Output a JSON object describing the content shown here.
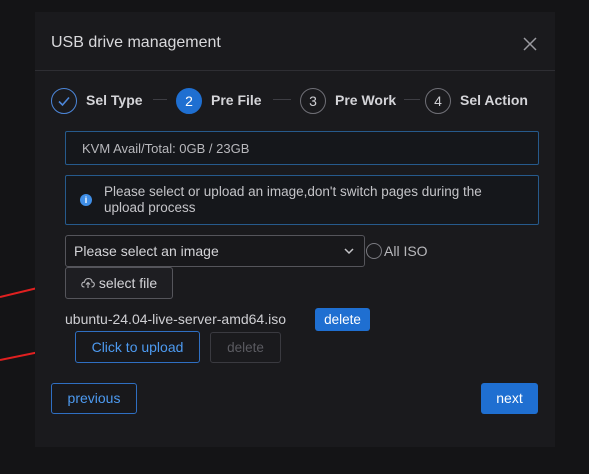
{
  "dialog": {
    "title": "USB drive management"
  },
  "steps": [
    {
      "number": "",
      "label": "Sel Type",
      "state": "done"
    },
    {
      "number": "2",
      "label": "Pre File",
      "state": "active"
    },
    {
      "number": "3",
      "label": "Pre Work",
      "state": "pending"
    },
    {
      "number": "4",
      "label": "Sel Action",
      "state": "pending"
    }
  ],
  "kvm_info": "KVM Avail/Total: 0GB / 23GB",
  "alert": {
    "icon": "info-icon",
    "text": "Please select or upload an image,don't switch pages during the upload process"
  },
  "image_select": {
    "placeholder": "Please select an image",
    "all_iso_label": "All ISO"
  },
  "select_file_label": "select file",
  "uploaded_file": {
    "name": "ubuntu-24.04-live-server-amd64.iso",
    "delete_label": "delete"
  },
  "upload": {
    "upload_label": "Click to upload",
    "delete_label": "delete"
  },
  "footer": {
    "previous_label": "previous",
    "next_label": "next"
  },
  "colors": {
    "accent": "#1f6fd1",
    "annotation_arrow": "#e02020"
  }
}
